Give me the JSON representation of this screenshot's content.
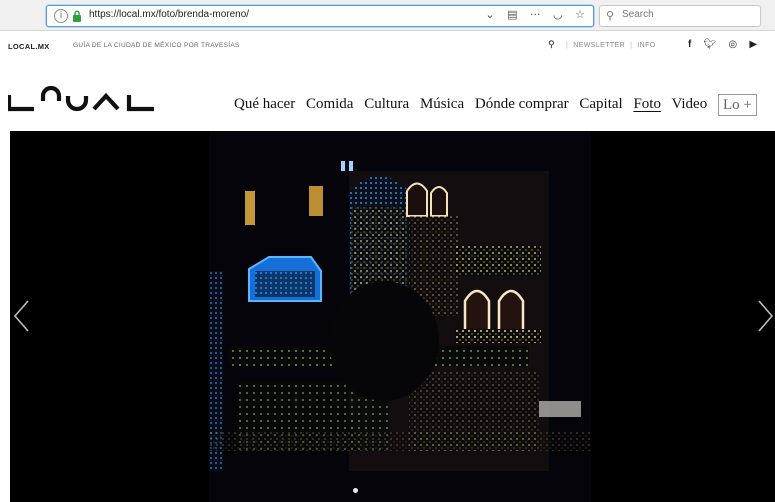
{
  "browser": {
    "url": "https://local.mx/foto/brenda-moreno/",
    "url_icons": [
      "chevron-down-icon",
      "reader-icon",
      "more-icon",
      "pocket-icon",
      "bookmark-star-icon"
    ],
    "search_placeholder": "Search"
  },
  "site": {
    "brand_small": "LOCAL.MX",
    "tagline": "GUÍA DE LA CIUDAD DE MÉXICO POR TRAVESÍAS",
    "top_links": [
      "NEWSLETTER",
      "INFO"
    ],
    "socials": [
      "facebook-icon",
      "twitter-icon",
      "instagram-icon",
      "youtube-icon"
    ]
  },
  "nav": {
    "items": [
      {
        "label": "Qué hacer",
        "active": false
      },
      {
        "label": "Comida",
        "active": false
      },
      {
        "label": "Cultura",
        "active": false
      },
      {
        "label": "Música",
        "active": false
      },
      {
        "label": "Dónde comprar",
        "active": false
      },
      {
        "label": "Capital",
        "active": false
      },
      {
        "label": "Foto",
        "active": true
      },
      {
        "label": "Video",
        "active": false
      }
    ],
    "more_label": "Lo +"
  },
  "gallery": {
    "photo_subject": "house-decorated-with-christmas-lights",
    "current_slide": 1
  },
  "colors": {
    "accent_blue": "#5b9bd5",
    "lock_green": "#2e9e3e"
  }
}
